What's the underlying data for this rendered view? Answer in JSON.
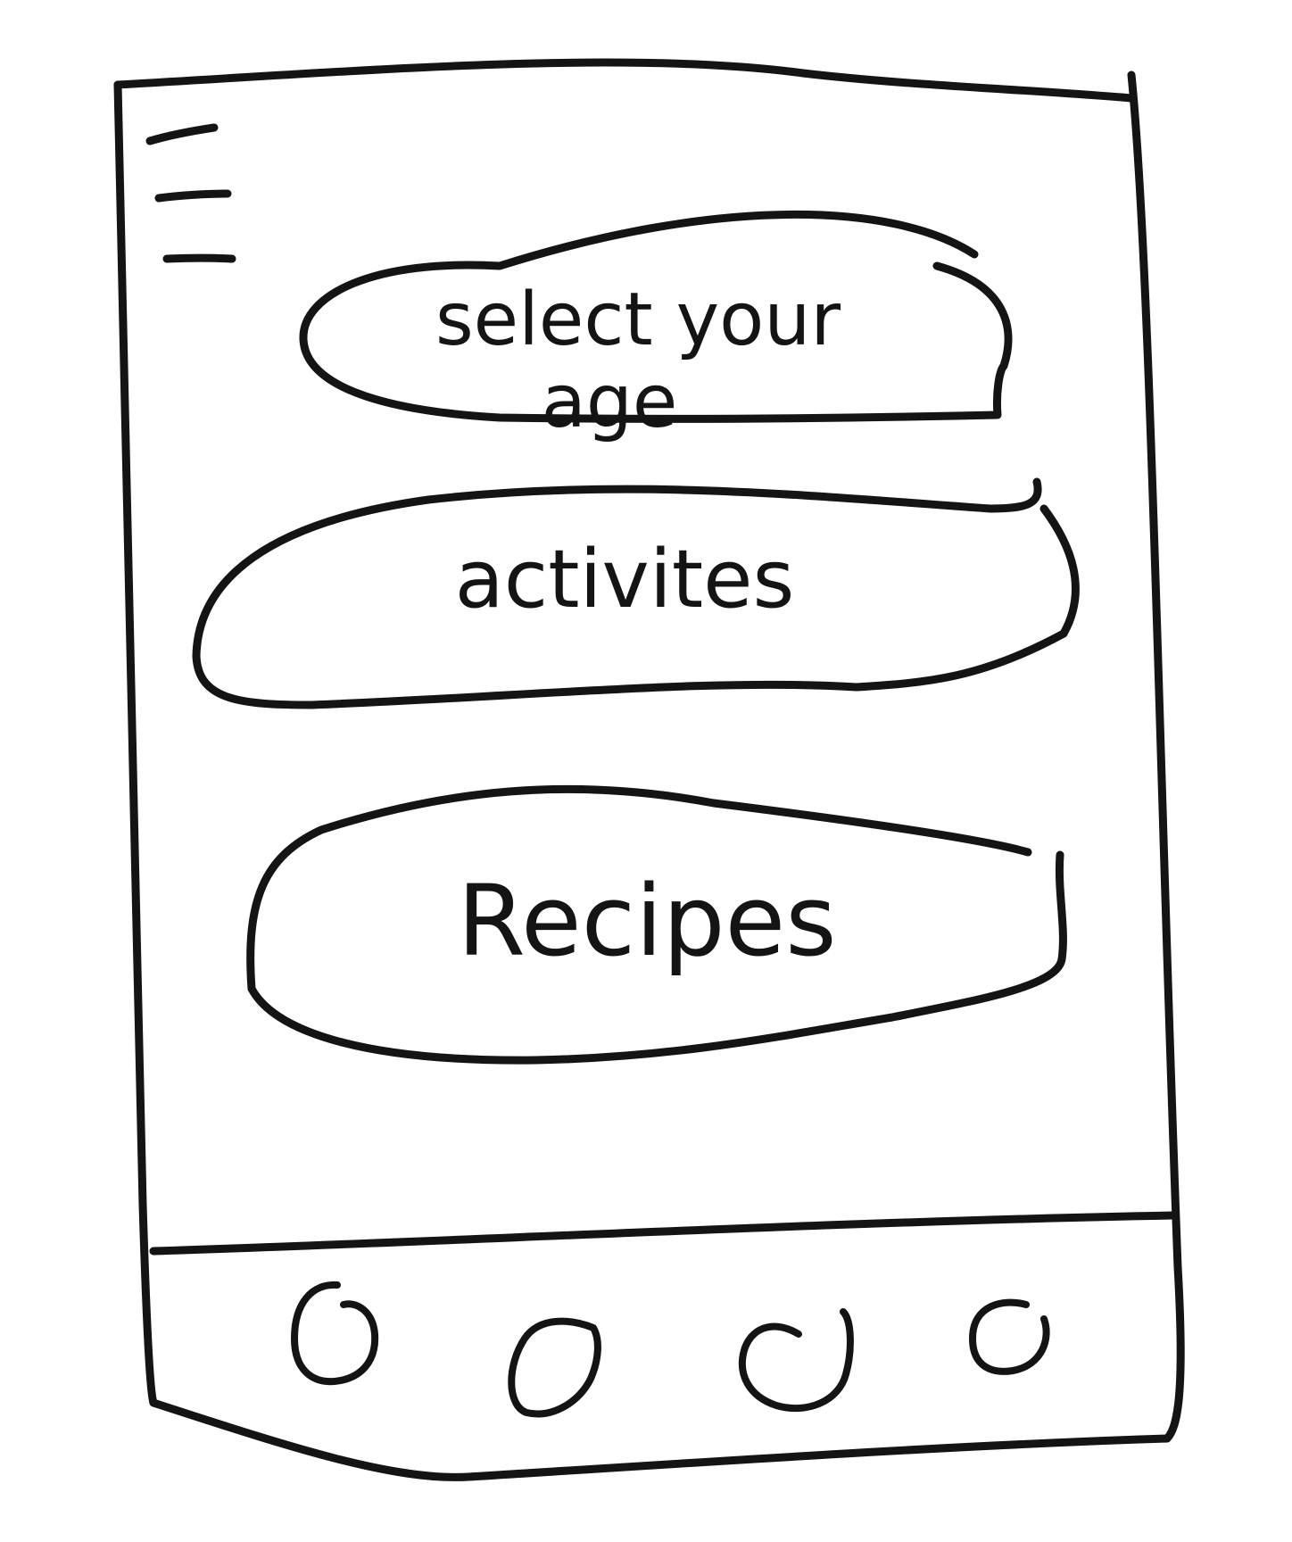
{
  "buttons": {
    "age": {
      "label_line1": "select your",
      "label_line2": "age"
    },
    "activities": {
      "label": "activites"
    },
    "recipes": {
      "label": "Recipes"
    }
  },
  "icons": {
    "menu": "hamburger-menu-icon",
    "nav": [
      "nav-icon-1",
      "nav-icon-2",
      "nav-icon-3",
      "nav-icon-4"
    ]
  },
  "colors": {
    "ink": "#141414",
    "paper": "#ffffff"
  }
}
